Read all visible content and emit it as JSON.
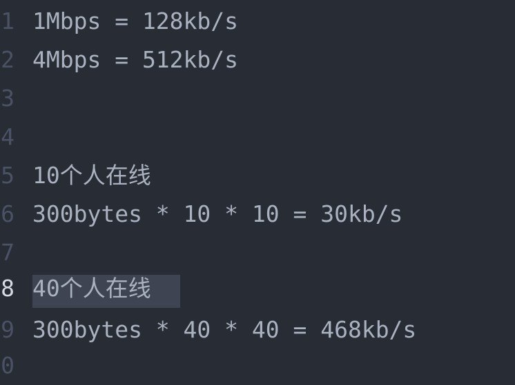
{
  "editor": {
    "lines": [
      {
        "number": "1",
        "text": "1Mbps = 128kb/s"
      },
      {
        "number": "2",
        "text": "4Mbps = 512kb/s"
      },
      {
        "number": "3",
        "text": ""
      },
      {
        "number": "4",
        "text": ""
      },
      {
        "number": "5",
        "text": "10个人在线"
      },
      {
        "number": "6",
        "text": "300bytes * 10 * 10 = 30kb/s"
      },
      {
        "number": "7",
        "text": ""
      },
      {
        "number": "8",
        "text": "40个人在线"
      },
      {
        "number": "9",
        "text": "300bytes * 40 * 40 = 468kb/s"
      },
      {
        "number": "0",
        "text": ""
      }
    ],
    "current_line": "8",
    "colors": {
      "background": "#282c34",
      "text": "#abb2bf",
      "gutter": "#4b5263",
      "gutter_current": "#d7dae0",
      "selection": "#3e4451"
    }
  }
}
